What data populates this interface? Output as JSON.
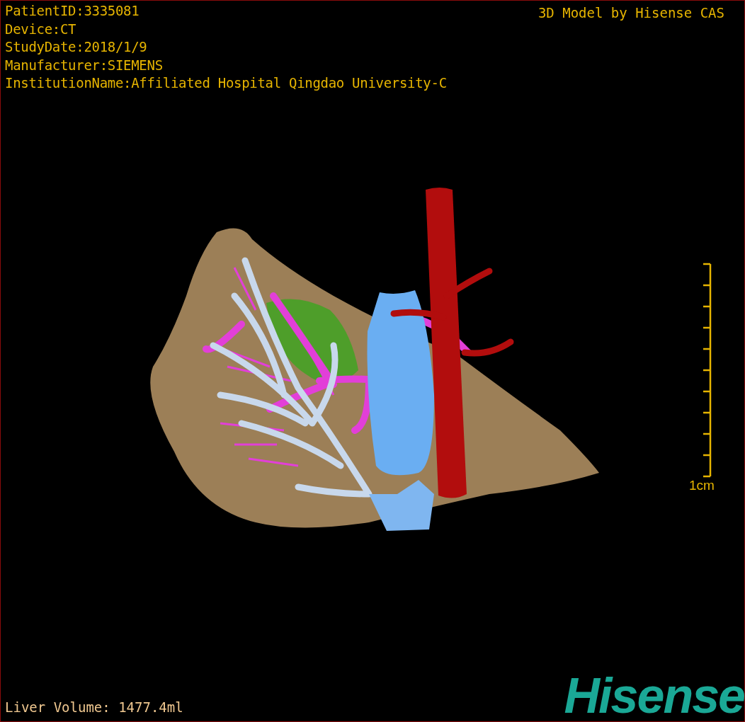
{
  "info_lines": [
    "PatientID:3335081",
    "Device:CT",
    "StudyDate:2018/1/9",
    "Manufacturer:SIEMENS",
    "InstitutionName:Affiliated Hospital Qingdao University-C"
  ],
  "title": "3D Model by Hisense CAS",
  "scale_bar": {
    "label": "1cm"
  },
  "liver_volume": "Liver Volume: 1477.4ml",
  "logo": "Hisense"
}
